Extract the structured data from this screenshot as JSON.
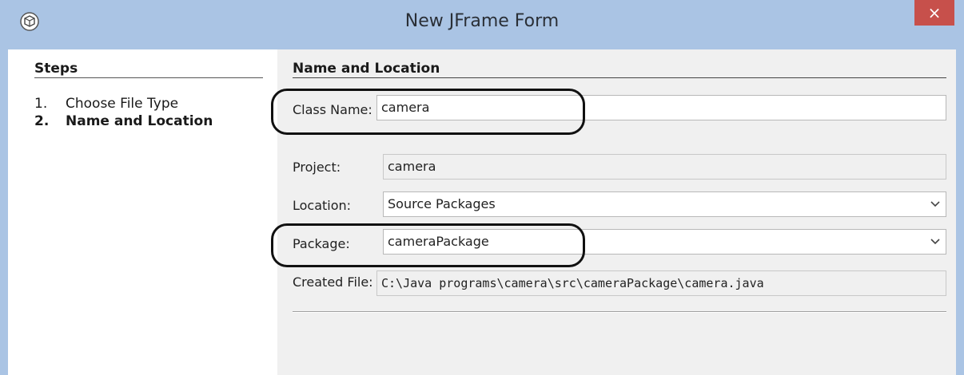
{
  "window": {
    "title": "New JFrame Form",
    "close_symbol": "×",
    "app_icon": "cube-icon",
    "titlebar_color": "#aac4e4",
    "close_color": "#c7504b"
  },
  "steps": {
    "heading": "Steps",
    "items": [
      {
        "number": "1.",
        "label": "Choose File Type"
      },
      {
        "number": "2.",
        "label": "Name and Location"
      }
    ]
  },
  "form": {
    "heading": "Name and Location",
    "class_name": {
      "label": "Class Name:",
      "value": "camera"
    },
    "project": {
      "label": "Project:",
      "value": "camera"
    },
    "location": {
      "label": "Location:",
      "value": "Source Packages",
      "icon": "chevron-down-icon"
    },
    "package": {
      "label": "Package:",
      "value": "cameraPackage",
      "icon": "chevron-down-icon"
    },
    "created_file": {
      "label": "Created File:",
      "value": "C:\\Java programs\\camera\\src\\cameraPackage\\camera.java"
    }
  }
}
